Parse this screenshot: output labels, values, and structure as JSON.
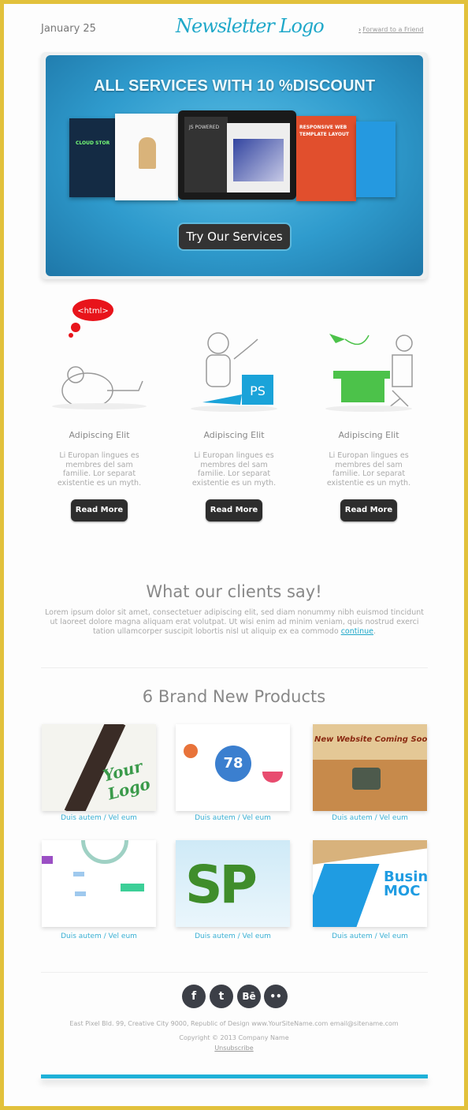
{
  "header": {
    "date": "January 25",
    "logo": "Newsletter Logo",
    "forward_link": "Forward to a Friend"
  },
  "hero": {
    "title": "ALL SERVICES WITH 10 %DISCOUNT",
    "button": "Try Our Services",
    "screen_texts": [
      "JS POWERED",
      "RESPONSIVE WEB TEMPLATE LAYOUT",
      "CLOUD STOR"
    ]
  },
  "features": [
    {
      "badge": "<html>",
      "title": "Adipiscing Elit",
      "text": "Li Europan lingues es membres del sam familie. Lor separat existentie es un myth.",
      "button": "Read More"
    },
    {
      "badge": "PS",
      "title": "Adipiscing Elit",
      "text": "Li Europan lingues es membres del sam familie. Lor separat existentie es un myth.",
      "button": "Read More"
    },
    {
      "title": "Adipiscing Elit",
      "text": "Li Europan lingues es membres del sam familie. Lor separat existentie es un myth.",
      "button": "Read More"
    }
  ],
  "testimonial": {
    "heading": "What our clients say!",
    "text": "Lorem ipsum dolor sit amet, consectetuer adipiscing elit, sed diam nonummy nibh euismod tincidunt ut laoreet dolore magna aliquam erat volutpat. Ut wisi enim ad minim veniam, quis nostrud exerci tation ullamcorper suscipit lobortis nisl ut aliquip ex ea commodo",
    "link": "continue"
  },
  "products": {
    "heading": "6 Brand New Products",
    "items": [
      {
        "caption": "Duis autem / Vel eum",
        "image_text": "Your Logo"
      },
      {
        "caption": "Duis autem / Vel eum",
        "image_text": "78"
      },
      {
        "caption": "Duis autem / Vel eum",
        "image_text": "New Website Coming Soo"
      },
      {
        "caption": "Duis autem / Vel eum",
        "image_text": ""
      },
      {
        "caption": "Duis autem / Vel eum",
        "image_text": "SP"
      },
      {
        "caption": "Duis autem / Vel eum",
        "image_text": "Busin MOC"
      }
    ]
  },
  "social": [
    {
      "icon": "facebook-icon",
      "glyph": "f"
    },
    {
      "icon": "twitter-icon",
      "glyph": "t"
    },
    {
      "icon": "behance-icon",
      "glyph": "Bē"
    },
    {
      "icon": "flickr-icon",
      "glyph": "••"
    }
  ],
  "footer": {
    "address": "East Pixel Bld. 99, Creative City 9000, Republic of Design www.YourSiteName.com email@sitename.com",
    "copyright": "Copyright © 2013 Company Name",
    "unsubscribe": "Unsubscribe"
  },
  "colors": {
    "accent": "#1fa8c9",
    "frame": "#e2c13c",
    "button": "#2d2d2d"
  }
}
